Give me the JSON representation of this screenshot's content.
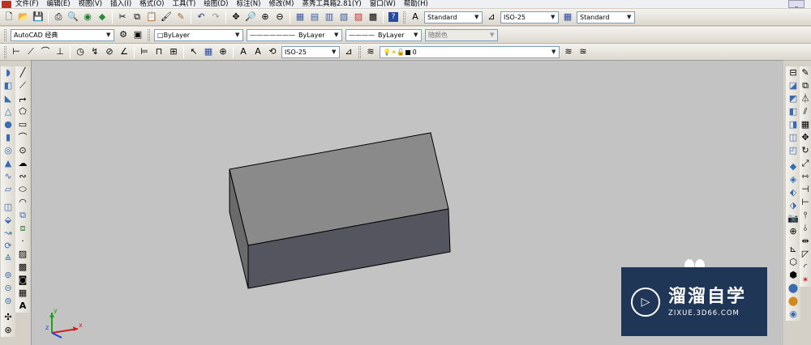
{
  "menubar": {
    "items": [
      "文件(F)",
      "编辑(E)",
      "视图(V)",
      "插入(I)",
      "格式(O)",
      "工具(T)",
      "绘图(D)",
      "标注(N)",
      "修改(M)",
      "蒸秀工具箱2.81(Y)",
      "窗口(W)",
      "帮助(H)"
    ],
    "minimize": "_"
  },
  "toolbar1": {
    "text_style": "Standard",
    "dim_style": "ISO-25",
    "table_style": "Standard"
  },
  "toolbar2": {
    "workspace": "AutoCAD 经典",
    "layer_control": "ByLayer",
    "linetype": "ByLayer",
    "lineweight": "ByLayer",
    "plot_style": "随颜色"
  },
  "toolbar3": {
    "dim_style": "ISO-25",
    "layer_name": "0"
  },
  "colors": {
    "canvas_bg": "#c3c3c3",
    "box_top": "#8a8a8a",
    "box_front": "#555560",
    "box_side": "#6a6a6a",
    "watermark_bg": "#1f3656"
  },
  "watermark": {
    "name": "溜溜自学",
    "url": "ZIXUE.3D66.COM"
  },
  "ucs": {
    "x": "x",
    "y": "y",
    "z": "z"
  }
}
